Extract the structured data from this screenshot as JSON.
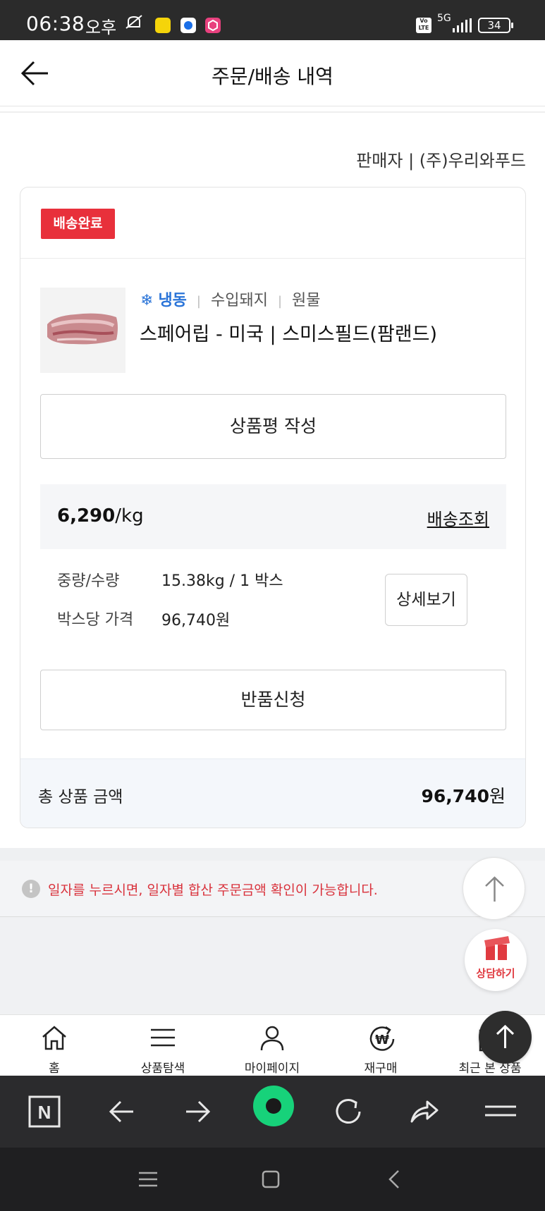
{
  "status_bar": {
    "time": "06:38",
    "ampm": "오후",
    "network": "5G",
    "volte": "Vo LTE",
    "battery": "34"
  },
  "header": {
    "title": "주문/배송 내역"
  },
  "seller": {
    "text": "판매자 | (주)우리와푸드"
  },
  "order": {
    "status_badge": "배송완료",
    "category": {
      "storage": "냉동",
      "type": "수입돼지",
      "form": "원물"
    },
    "product_name": "스페어립 - 미국 | 스미스필드(팜랜드)",
    "review_button": "상품평 작성",
    "unit_price": {
      "amount": "6,290",
      "unit": "/kg"
    },
    "track_link": "배송조회",
    "weight_label": "중량/수량",
    "weight_value": "15.38kg / 1 박스",
    "box_price_label": "박스당 가격",
    "box_price_value": "96,740원",
    "detail_button": "상세보기",
    "return_button": "반품신청",
    "total_label": "총 상품 금액",
    "total_amount": "96,740",
    "total_currency": "원"
  },
  "notice": {
    "text": "일자를 누르시면, 일자별 합산 주문금액 확인이 가능합니다."
  },
  "chat_fab": {
    "label": "상담하기"
  },
  "bottom_nav": {
    "items": [
      {
        "label": "홈",
        "icon": "home-icon"
      },
      {
        "label": "상품탐색",
        "icon": "menu-icon"
      },
      {
        "label": "마이페이지",
        "icon": "person-icon"
      },
      {
        "label": "재구매",
        "icon": "won-refresh-icon"
      },
      {
        "label": "최근 본 상품",
        "icon": "recent-icon"
      }
    ]
  },
  "colors": {
    "badge_red": "#e8303b",
    "frozen_blue": "#2a74d8",
    "notice_red": "#d9323c",
    "total_bg": "#f4f7fb",
    "browser_green": "#17d27a"
  }
}
